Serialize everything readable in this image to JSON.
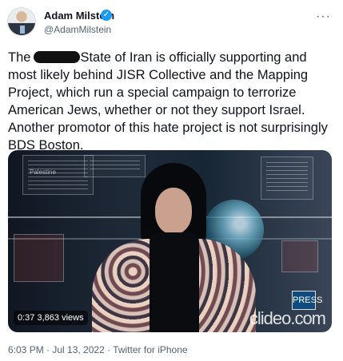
{
  "user": {
    "name": "Adam Milstein",
    "handle": "@AdamMilstein",
    "verified_mark": "✓",
    "more_label": "···"
  },
  "tweet": {
    "part1": "The",
    "part2": "State of Iran is officially supporting and most likely behind JISR Collective and the Mapping Project, which run a special campaign to terrorize American Jews, whether or not they support Israel. Another promotor of this hate project is not surprisingly BDS Boston."
  },
  "video": {
    "duration": "0:37",
    "views": "3,863 views",
    "watermark": "clideo.com",
    "screen_label": "Palestine",
    "logo_label": "PRESS",
    "icons": [
      "play-icon"
    ]
  },
  "meta": {
    "timestamp": "6:03 PM · Jul 13, 2022 · Twitter for iPhone"
  },
  "colors": {
    "verified": "#1d9bf0",
    "text": "#0f1419",
    "secondary": "#536471"
  }
}
